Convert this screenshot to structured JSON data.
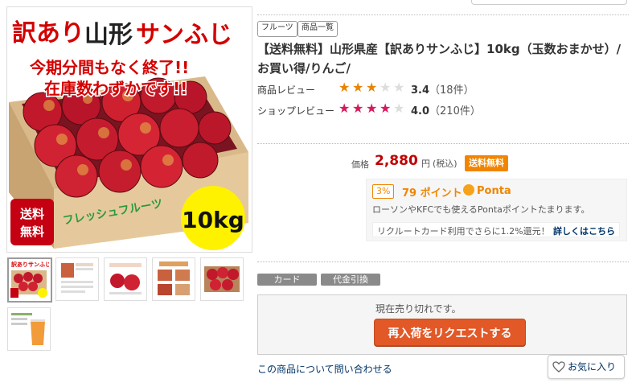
{
  "main_image": {
    "banner_line1_a": "訳あり",
    "banner_line1_b": "山形",
    "banner_line1_c": "サンふじ",
    "notice_line1": "今期分間もなく終了!!",
    "notice_line2": "在庫数わずかです!!",
    "badge_shipping": "送料無料",
    "weight": "10kg",
    "box_text": "フレッシュフルーツ"
  },
  "thumbnails": [
    {
      "name": "thumb-main"
    },
    {
      "name": "thumb-2"
    },
    {
      "name": "thumb-3"
    },
    {
      "name": "thumb-4"
    },
    {
      "name": "thumb-5"
    },
    {
      "name": "thumb-6"
    }
  ],
  "tags": [
    "フルーツ",
    "商品一覧"
  ],
  "title": "【送料無料】山形県産【訳ありサンふじ】10kg（玉数おまかせ）/お買い得/りんご/",
  "reviews": {
    "product": {
      "label": "商品レビュー",
      "score": "3.4",
      "count": "（18件）",
      "filled": 3,
      "color": "#e88400"
    },
    "shop": {
      "label": "ショップレビュー",
      "score": "4.0",
      "count": "（210件）",
      "filled": 4,
      "color": "#d6195d"
    }
  },
  "price": {
    "label": "価格",
    "value": "2,880",
    "unit": "円",
    "tax": "(税込)",
    "shipping": "送料無料"
  },
  "points": {
    "rate": "3%",
    "amount": "79 ポイント",
    "brand": "Ponta",
    "note": "ローソンやKFCでも使えるPontaポイントたまります。",
    "card_note": "リクルートカード利用でさらに1.2%還元！",
    "card_link": "詳しくはこちら"
  },
  "payments": [
    "カード",
    "代金引換"
  ],
  "stock": {
    "status": "現在売り切れです。",
    "restock_button": "再入荷をリクエストする"
  },
  "inquiry_link": "この商品について問い合わせる",
  "favorite_button": "お気に入り",
  "colors": {
    "price_red": "#bf0000",
    "accent_orange": "#f18500",
    "button_orange": "#e25827",
    "link_blue": "#003366"
  }
}
